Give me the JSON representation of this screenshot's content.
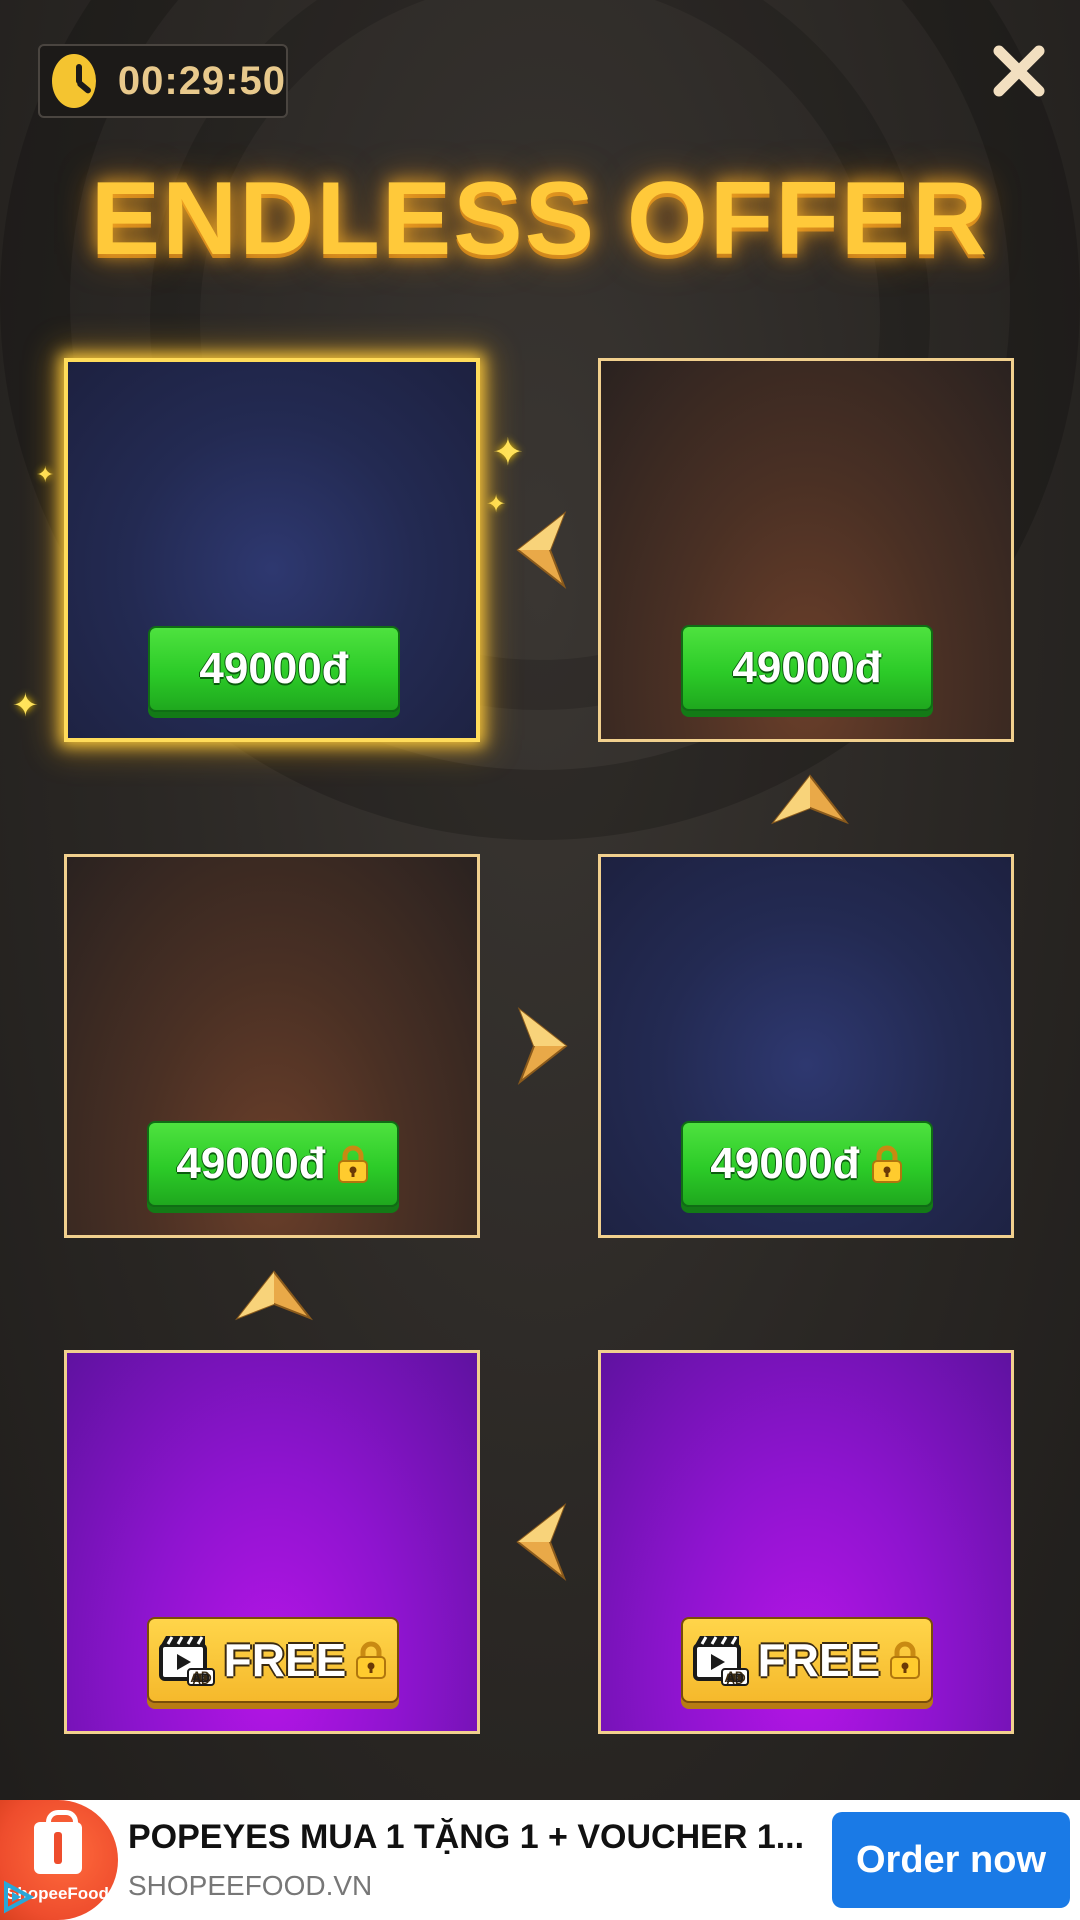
{
  "header": {
    "timer": "00:29:50",
    "title": "ENDLESS OFFER"
  },
  "offers": [
    {
      "price": "49000đ",
      "locked": false,
      "selected": true
    },
    {
      "price": "49000đ",
      "locked": false,
      "selected": false
    },
    {
      "price": "49000đ",
      "locked": true,
      "selected": false
    },
    {
      "price": "49000đ",
      "locked": true,
      "selected": false
    },
    {
      "label": "FREE",
      "locked": true,
      "ad_badge": "AD"
    },
    {
      "label": "FREE",
      "locked": true,
      "ad_badge": "AD"
    }
  ],
  "ad": {
    "logo_text": "ShopeeFood",
    "title": "POPEYES MUA 1 TẶNG 1 + VOUCHER 1...",
    "domain": "SHOPEEFOOD.VN",
    "cta": "Order now"
  },
  "colors": {
    "accent_gold": "#ffc93a",
    "price_green": "#2ccb28",
    "free_yellow": "#f5b92c",
    "cta_blue": "#1a7ae6"
  }
}
